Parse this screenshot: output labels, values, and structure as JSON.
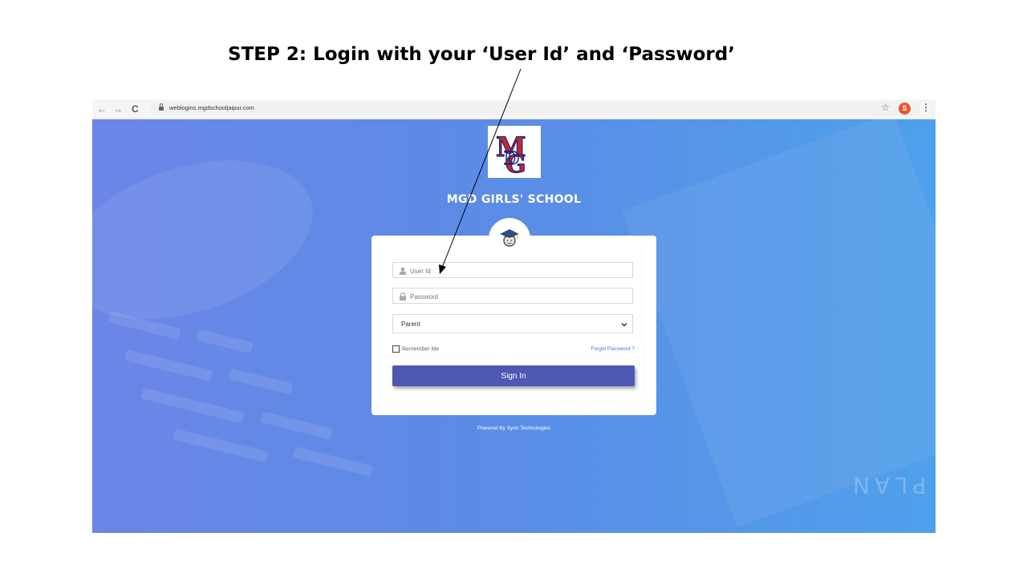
{
  "step": {
    "title": "STEP 2: Login with your ‘User Id’ and ‘Password’"
  },
  "browser": {
    "url": "weblogins.mgdschooljaipur.com",
    "nav_back": "←",
    "nav_forward": "→",
    "nav_reload": "C",
    "bookmark": "☆",
    "avatar_letter": "S",
    "menu": "⋮"
  },
  "login": {
    "school_name": "MGD GIRLS' SCHOOL",
    "user_id_placeholder": "User Id",
    "password_placeholder": "Password",
    "role_selected": "Parent",
    "remember_label": "Remember Me",
    "forgot_label": "Forgot Password ?",
    "sign_in_label": "Sign In",
    "powered_by": "Powered By Syon Technologies"
  },
  "colors": {
    "sign_in": "#4d59b5",
    "link": "#3a7bd5",
    "background_start": "#6b86e6",
    "background_end": "#4fa0ea",
    "avatar": "#e8572b"
  },
  "icons": [
    "back-arrow-icon",
    "forward-arrow-icon",
    "reload-icon",
    "lock-icon",
    "star-icon",
    "menu-dots-icon",
    "graduate-icon",
    "user-icon",
    "padlock-icon",
    "chevron-down-icon"
  ]
}
